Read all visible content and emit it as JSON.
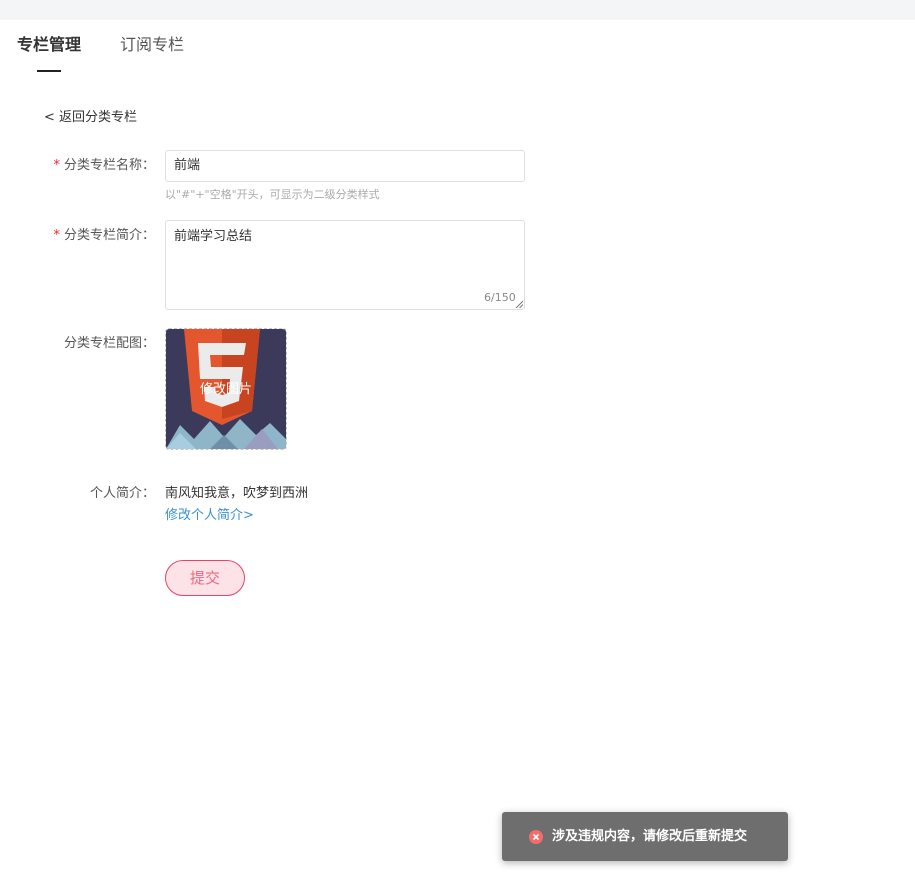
{
  "tabs": [
    {
      "label": "专栏管理"
    },
    {
      "label": "订阅专栏"
    }
  ],
  "back_link": "< 返回分类专栏",
  "form": {
    "name": {
      "label": "分类专栏名称：",
      "required_mark": "*",
      "value": "前端",
      "hint": "以\"#\"+\"空格\"开头，可显示为二级分类样式"
    },
    "description": {
      "label": "分类专栏简介：",
      "required_mark": "*",
      "value": "前端学习总结",
      "counter": "6/150"
    },
    "cover": {
      "label": "分类专栏配图：",
      "overlay_text": "修改图片",
      "image": "html5-logo-icon"
    },
    "bio": {
      "label": "个人简介：",
      "text": "南风知我意，吹梦到西洲",
      "edit_link": "修改个人简介>"
    },
    "submit_label": "提交"
  },
  "toast": {
    "icon": "error-circle-icon",
    "message": "涉及违规内容，请修改后重新提交"
  },
  "colors": {
    "accent_link": "#3a8fd9",
    "required": "#f5222d",
    "submit_border": "#e8436a",
    "submit_bg": "#fde2e7",
    "toast_bg": "#6e6e6e",
    "error_icon": "#f56c6c"
  }
}
